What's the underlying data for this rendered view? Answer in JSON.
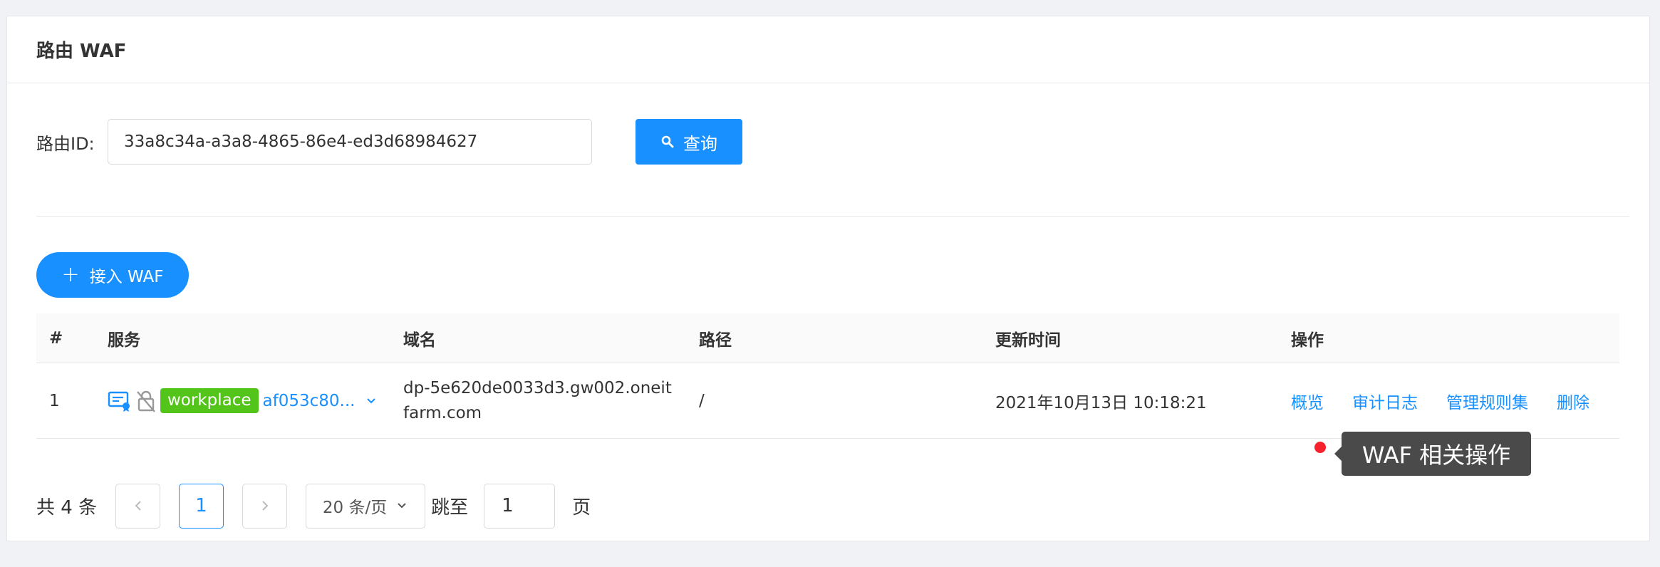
{
  "page": {
    "title": "路由 WAF"
  },
  "filter": {
    "label": "路由ID:",
    "value": "33a8c34a-a3a8-4865-86e4-ed3d68984627",
    "query_label": "查询"
  },
  "actions": {
    "add_label": "接入 WAF"
  },
  "table": {
    "headers": [
      "#",
      "服务",
      "域名",
      "路径",
      "更新时间",
      "操作"
    ],
    "rows": [
      {
        "index": "1",
        "service_tag": "workplace",
        "service_id": "af053c80...",
        "domain": "dp-5e620de0033d3.gw002.oneitfarm.com",
        "path": "/",
        "updated": "2021年10月13日 10:18:21",
        "ops": [
          "概览",
          "审计日志",
          "管理规则集",
          "删除"
        ]
      }
    ]
  },
  "pagination": {
    "total": "共 4 条",
    "current": "1",
    "page_size": "20 条/页",
    "jump_label": "跳至",
    "jump_value": "1",
    "page_suffix": "页"
  },
  "tooltip": {
    "text": "WAF 相关操作"
  },
  "colors": {
    "primary": "#1890ff",
    "tag_green": "#52c41a",
    "marker_red": "#f5222d"
  }
}
